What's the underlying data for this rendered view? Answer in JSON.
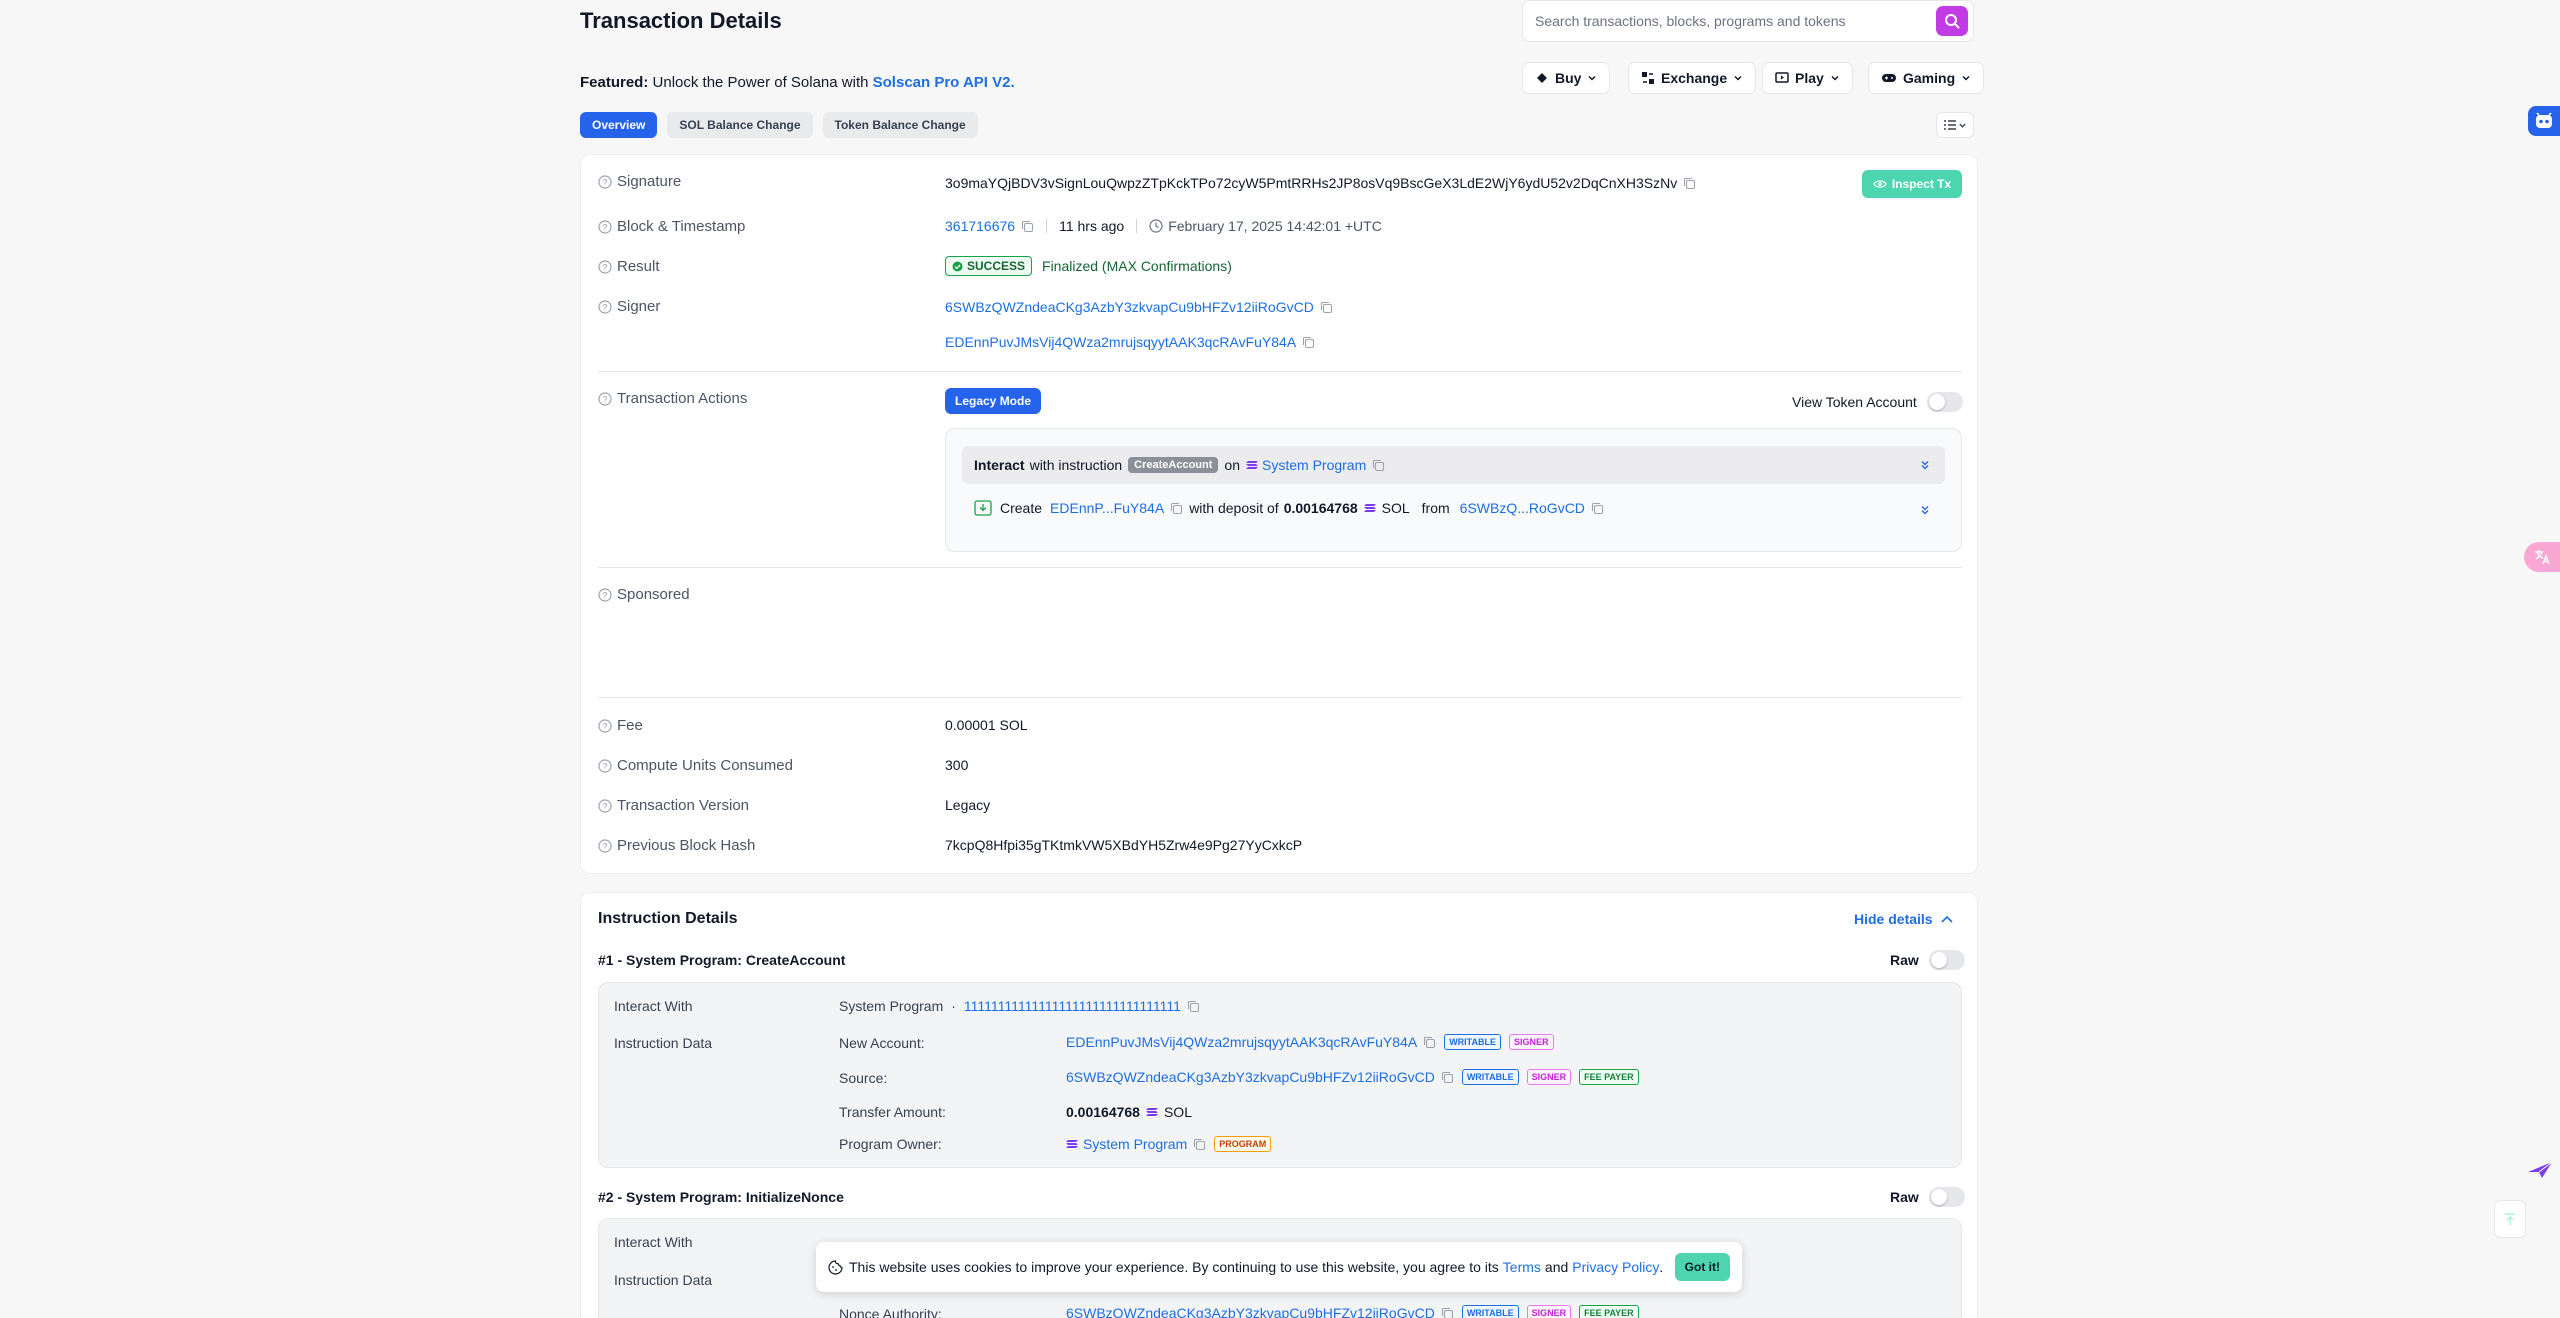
{
  "header": {
    "title": "Transaction Details",
    "search_placeholder": "Search transactions, blocks, programs and tokens"
  },
  "featured": {
    "label": "Featured:",
    "text": "Unlock the Power of Solana with",
    "link": "Solscan Pro API V2."
  },
  "nav": {
    "buy": "Buy",
    "exchange": "Exchange",
    "play": "Play",
    "gaming": "Gaming"
  },
  "tabs": [
    "Overview",
    "SOL Balance Change",
    "Token Balance Change"
  ],
  "overview": {
    "signature_label": "Signature",
    "signature": "3o9maYQjBDV3vSignLouQwpzZTpKckTPo72cyW5PmtRRHs2JP8osVq9BscGeX3LdE2WjY6ydU52v2DqCnXH3SzNv",
    "inspect_label": "Inspect Tx",
    "block_label": "Block & Timestamp",
    "block": "361716676",
    "ago": "11 hrs ago",
    "timestamp": "February 17, 2025 14:42:01 +UTC",
    "result_label": "Result",
    "result_badge": "SUCCESS",
    "result_text": "Finalized (MAX Confirmations)",
    "signer_label": "Signer",
    "signers": [
      "6SWBzQWZndeaCKg3AzbY3zkvapCu9bHFZv12iiRoGvCD",
      "EDEnnPuvJMsVij4QWza2mrujsqyytAAK3qcRAvFuY84A"
    ],
    "actions_label": "Transaction Actions",
    "legacy_mode": "Legacy Mode",
    "view_token_account": "View Token Account",
    "action1": {
      "interact": "Interact",
      "with_instruction": "with instruction",
      "instruction": "CreateAccount",
      "on": "on",
      "program": "System Program"
    },
    "action2": {
      "create": "Create",
      "account": "EDEnnP...FuY84A",
      "with_deposit": "with deposit of",
      "amount": "0.00164768",
      "unit": "SOL",
      "from": "from",
      "source": "6SWBzQ...RoGvCD"
    },
    "sponsored_label": "Sponsored",
    "fee_label": "Fee",
    "fee": "0.00001 SOL",
    "cu_label": "Compute Units Consumed",
    "cu": "300",
    "version_label": "Transaction Version",
    "version": "Legacy",
    "prev_hash_label": "Previous Block Hash",
    "prev_hash": "7kcpQ8Hfpi35gTKtmkVW5XBdYH5Zrw4e9Pg27YyCxkcP"
  },
  "instructions": {
    "title": "Instruction Details",
    "hide": "Hide details",
    "raw": "Raw",
    "interact_with": "Interact With",
    "instruction_data": "Instruction Data",
    "i1": {
      "title": "#1 - System Program: CreateAccount",
      "program": "System Program",
      "dot": "·",
      "program_id": "11111111111111111111111111111111",
      "new_account_label": "New Account:",
      "new_account": "EDEnnPuvJMsVij4QWza2mrujsqyytAAK3qcRAvFuY84A",
      "source_label": "Source:",
      "source": "6SWBzQWZndeaCKg3AzbY3zkvapCu9bHFZv12iiRoGvCD",
      "transfer_label": "Transfer Amount:",
      "transfer_amount": "0.00164768",
      "transfer_unit": "SOL",
      "owner_label": "Program Owner:",
      "owner": "System Program"
    },
    "i2": {
      "title": "#2 - System Program: InitializeNonce",
      "nonce_label": "Nonce Authority:",
      "nonce": "6SWBzQWZndeaCKg3AzbY3zkvapCu9bHFZv12iiRoGvCD"
    },
    "badges": {
      "writable": "WRITABLE",
      "signer": "SIGNER",
      "fee_payer": "FEE PAYER",
      "program": "PROGRAM"
    }
  },
  "cookie": {
    "text": "This website uses cookies to improve your experience. By continuing to use this website, you agree to its",
    "terms": "Terms",
    "and": "and",
    "privacy": "Privacy Policy",
    "period": ".",
    "button": "Got it!"
  },
  "colors": {
    "primary": "#2563eb",
    "link": "#1d6fe0",
    "search_button": "#c23ce6",
    "accent_green": "#4dd5b0"
  }
}
